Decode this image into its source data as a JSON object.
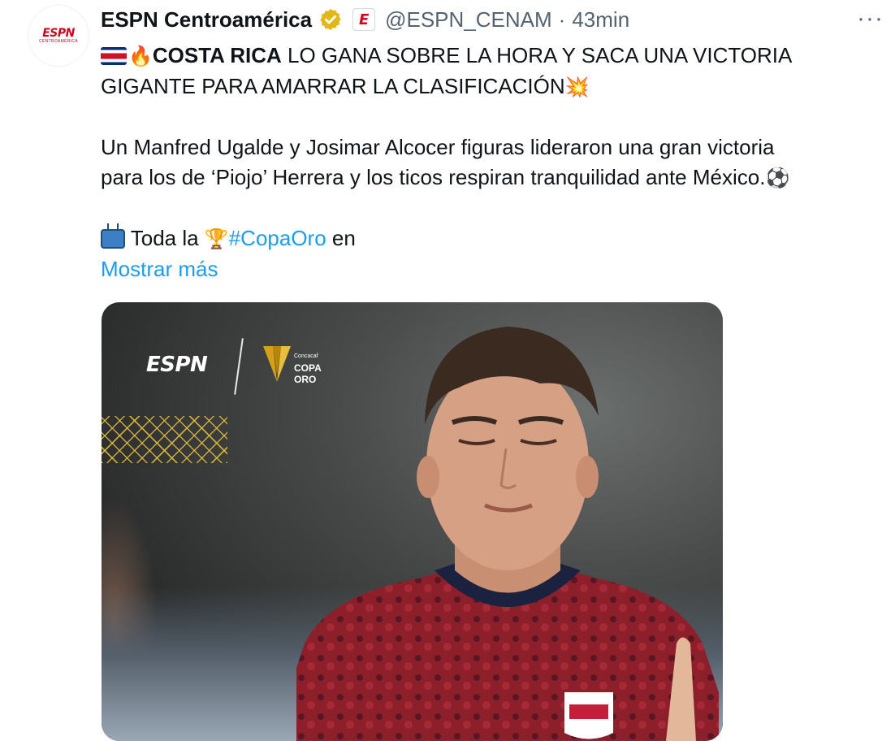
{
  "tweet": {
    "display_name": "ESPN Centroamérica",
    "handle": "@ESPN_CENAM",
    "separator": "·",
    "time": "43min",
    "more_glyph": "···",
    "avatar_logo": "ESPN",
    "avatar_sub": "CENTROAMÉRICA",
    "affiliate_badge": "E",
    "verified_color": "#e2b719",
    "text": {
      "line1_bold": "COSTA RICA",
      "line1_rest": " LO GANA SOBRE LA HORA Y SACA UNA VICTORIA",
      "line2": "GIGANTE PARA AMARRAR LA CLASIFICACIÓN",
      "line3": "Un Manfred Ugalde y Josimar Alcocer figuras lideraron una gran victoria",
      "line4": "para los de ‘Piojo’ Herrera y los ticos respiran tranquilidad ante México.",
      "line5_pre": " Toda la ",
      "hashtag": "#CopaOro",
      "line5_post": " en",
      "show_more": "Mostrar más"
    },
    "emojis": {
      "flag": "costa-rica-flag",
      "fire": "🔥",
      "collision": "💥",
      "ball": "⚽",
      "trophy": "🏆",
      "tv": "television"
    },
    "media": {
      "espn_logo": "ESPN",
      "copa_small": "Concacaf",
      "copa_line1": "COPA",
      "copa_line2": "ORO"
    },
    "colors": {
      "link": "#1d9bf0",
      "secondary": "#536471",
      "espn_red": "#d0021b"
    }
  }
}
